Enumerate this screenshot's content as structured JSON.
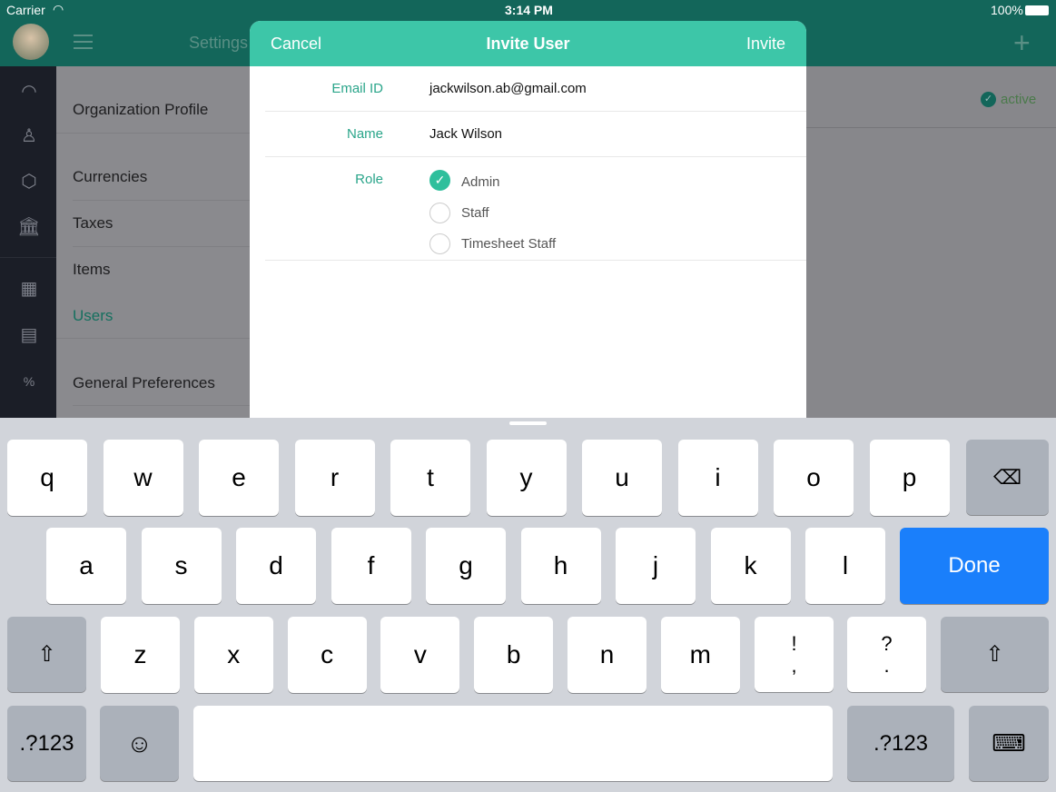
{
  "status": {
    "carrier": "Carrier",
    "time": "3:14 PM",
    "battery": "100%"
  },
  "header": {
    "title": "Settings"
  },
  "settings_list": {
    "items": [
      "Organization Profile",
      "Currencies",
      "Taxes",
      "Items",
      "Users",
      "General Preferences"
    ],
    "active": "Users"
  },
  "background": {
    "status": "active"
  },
  "modal": {
    "cancel": "Cancel",
    "title": "Invite User",
    "invite": "Invite",
    "email_label": "Email ID",
    "email_value": "jackwilson.ab@gmail.com",
    "name_label": "Name",
    "name_value": "Jack Wilson",
    "role_label": "Role",
    "roles": [
      "Admin",
      "Staff",
      "Timesheet Staff"
    ],
    "selected_role": "Admin"
  },
  "keyboard": {
    "row1": [
      "q",
      "w",
      "e",
      "r",
      "t",
      "y",
      "u",
      "i",
      "o",
      "p"
    ],
    "row2": [
      "a",
      "s",
      "d",
      "f",
      "g",
      "h",
      "j",
      "k",
      "l"
    ],
    "row3": [
      "z",
      "x",
      "c",
      "v",
      "b",
      "n",
      "m"
    ],
    "punct1": "!\n,",
    "punct2": "?\n.",
    "done": "Done",
    "numbers": ".?123"
  },
  "colors": {
    "header": "#13665a",
    "accent": "#3dc6a8",
    "done": "#1a7ffb"
  }
}
